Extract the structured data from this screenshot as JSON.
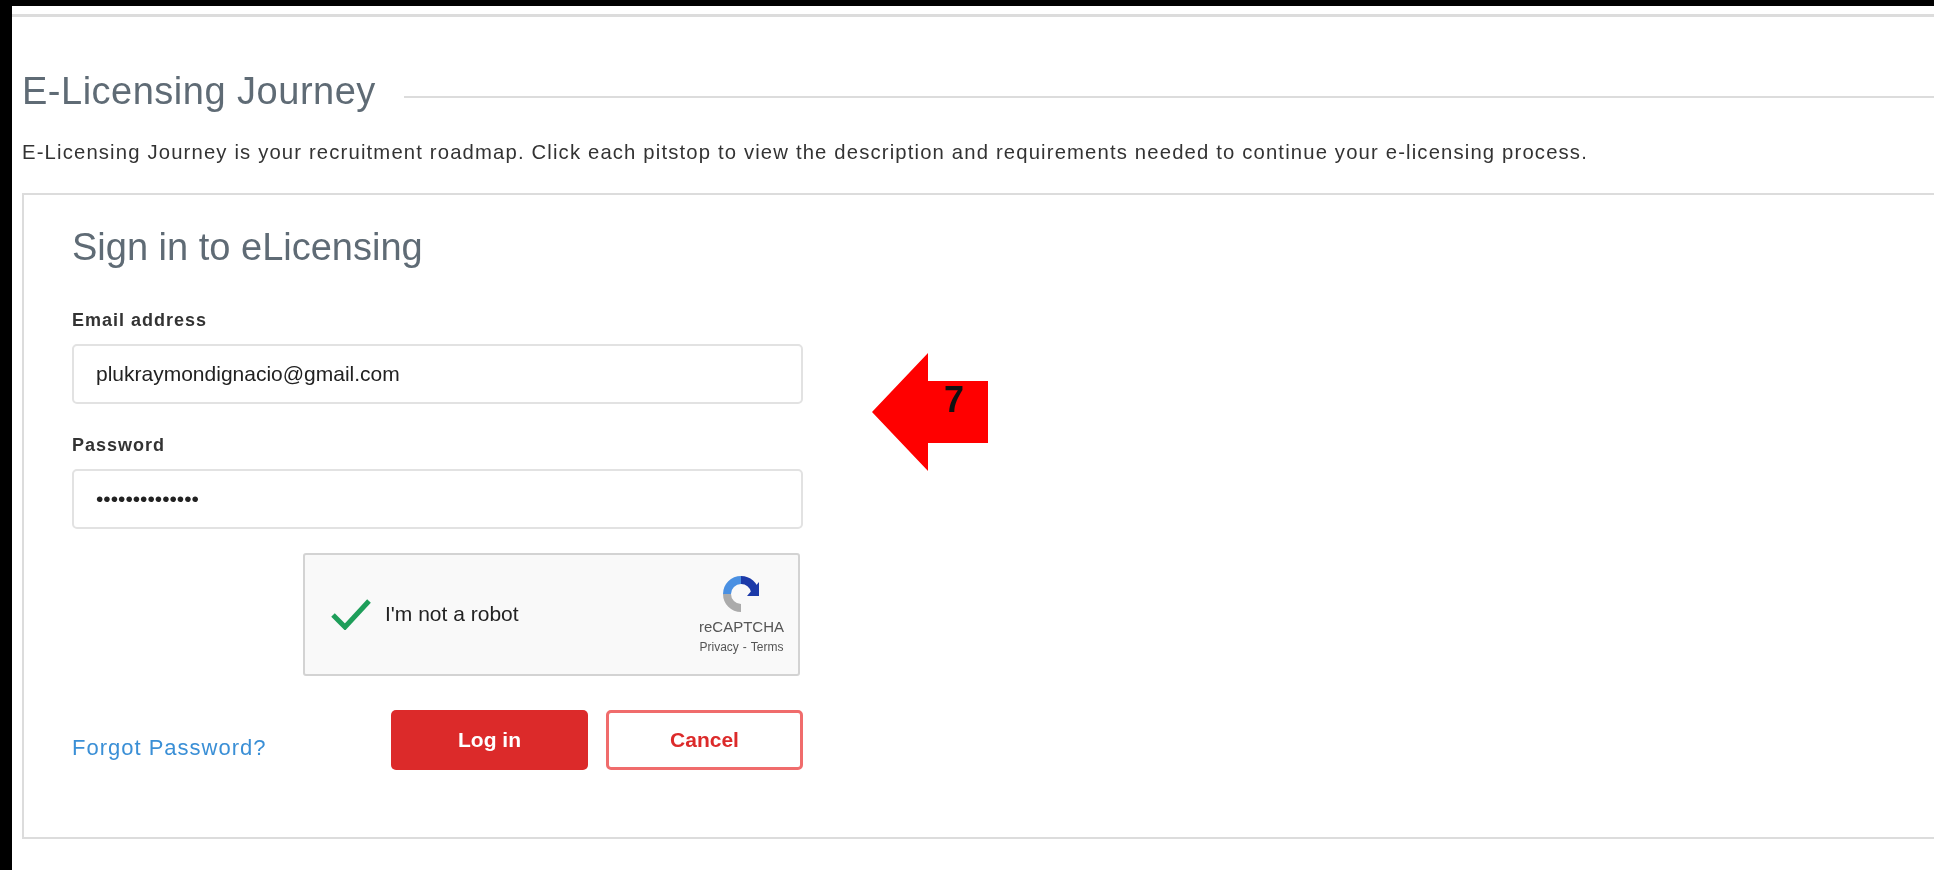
{
  "page": {
    "title": "E-Licensing Journey",
    "description": "E-Licensing Journey is your recruitment roadmap. Click each pitstop to view the description and requirements needed to continue your e-licensing process."
  },
  "form": {
    "title": "Sign in to eLicensing",
    "fields": [
      {
        "label": "Email address",
        "value": "plukraymondignacio@gmail.com"
      },
      {
        "label": "Password",
        "value": "••••••••••••••"
      }
    ],
    "captcha": {
      "label": "I'm not a robot",
      "checked": true,
      "brand": "reCAPTCHA",
      "privacy": "Privacy",
      "separator": "-",
      "terms": "Terms"
    },
    "forgot_link": "Forgot Password?",
    "buttons": [
      {
        "label": "Log in",
        "kind": "primary"
      },
      {
        "label": "Cancel",
        "kind": "outline"
      }
    ]
  },
  "annotation": {
    "label": "7"
  }
}
